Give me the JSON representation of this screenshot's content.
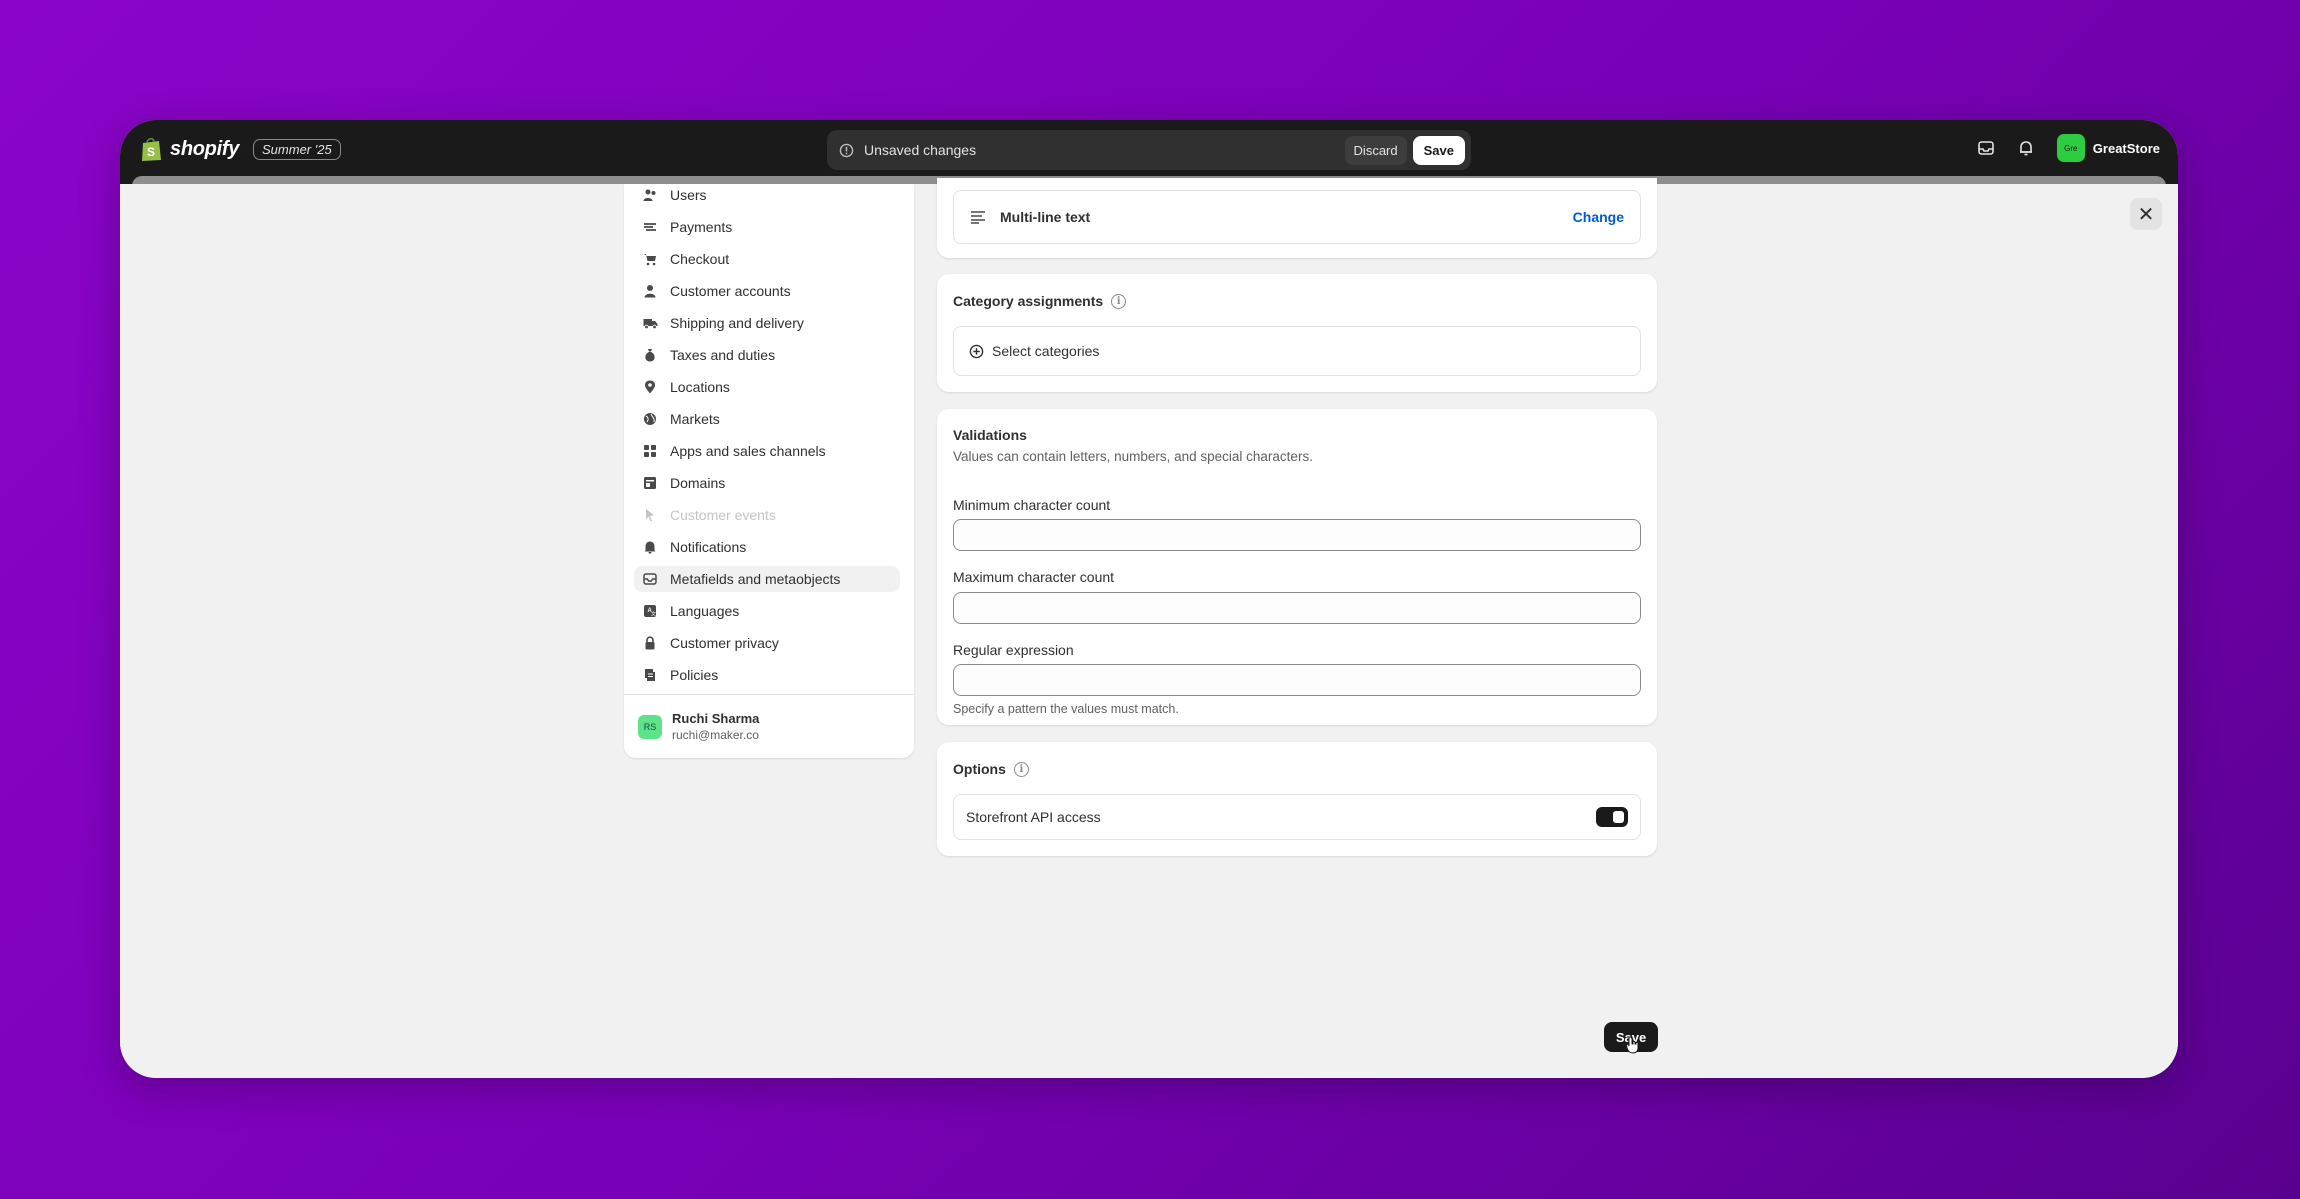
{
  "topbar": {
    "logo_text": "shopify",
    "edition": "Summer '25",
    "unsaved_text": "Unsaved changes",
    "discard_label": "Discard",
    "save_label": "Save",
    "store_initials": "Gre",
    "store_name": "GreatStore"
  },
  "sidebar": {
    "items": [
      {
        "label": "Users",
        "icon": "users-icon"
      },
      {
        "label": "Payments",
        "icon": "payments-icon"
      },
      {
        "label": "Checkout",
        "icon": "cart-icon"
      },
      {
        "label": "Customer accounts",
        "icon": "person-icon"
      },
      {
        "label": "Shipping and delivery",
        "icon": "truck-icon"
      },
      {
        "label": "Taxes and duties",
        "icon": "money-bag-icon"
      },
      {
        "label": "Locations",
        "icon": "location-pin-icon"
      },
      {
        "label": "Markets",
        "icon": "globe-icon"
      },
      {
        "label": "Apps and sales channels",
        "icon": "apps-icon"
      },
      {
        "label": "Domains",
        "icon": "domain-icon"
      },
      {
        "label": "Customer events",
        "icon": "cursor-icon",
        "disabled": true
      },
      {
        "label": "Notifications",
        "icon": "bell-icon"
      },
      {
        "label": "Metafields and metaobjects",
        "icon": "metafields-icon",
        "active": true
      },
      {
        "label": "Languages",
        "icon": "language-icon"
      },
      {
        "label": "Customer privacy",
        "icon": "lock-icon"
      },
      {
        "label": "Policies",
        "icon": "policy-icon"
      }
    ],
    "user": {
      "initials": "RS",
      "name": "Ruchi Sharma",
      "email": "ruchi@maker.co"
    }
  },
  "type_card": {
    "type_label": "Multi-line text",
    "change_label": "Change"
  },
  "category_card": {
    "title": "Category assignments",
    "select_label": "Select categories"
  },
  "validations_card": {
    "title": "Validations",
    "description": "Values can contain letters, numbers, and special characters.",
    "min_label": "Minimum character count",
    "min_value": "",
    "max_label": "Maximum character count",
    "max_value": "",
    "regex_label": "Regular expression",
    "regex_value": "",
    "regex_help": "Specify a pattern the values must match."
  },
  "options_card": {
    "title": "Options",
    "storefront_label": "Storefront API access",
    "storefront_enabled": true
  },
  "footer": {
    "save_label": "Save"
  }
}
